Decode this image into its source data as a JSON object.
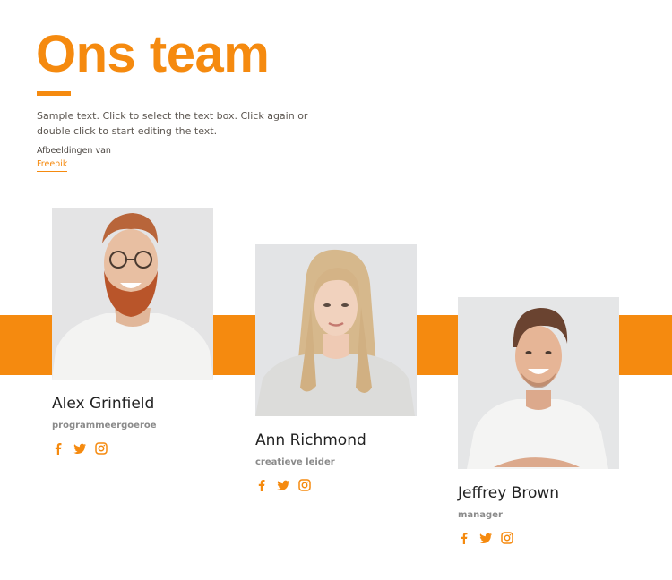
{
  "header": {
    "title": "Ons team",
    "intro": "Sample text. Click to select the text box. Click again or double click to start editing the text.",
    "credit_label": "Afbeeldingen van",
    "credit_link": "Freepik"
  },
  "colors": {
    "accent": "#f58a0f",
    "photo_bg": "#e5e5e6",
    "name_text": "#222222",
    "role_text": "#8a8a8a"
  },
  "team": [
    {
      "name": "Alex Grinfield",
      "role": "programmeergoeroe",
      "photo": "man with red beard and glasses, white t-shirt",
      "socials": [
        "facebook-icon",
        "twitter-icon",
        "instagram-icon"
      ]
    },
    {
      "name": "Ann Richmond",
      "role": "creatieve leider",
      "photo": "woman with long blonde hair, grey sweater",
      "socials": [
        "facebook-icon",
        "twitter-icon",
        "instagram-icon"
      ]
    },
    {
      "name": "Jeffrey Brown",
      "role": "manager",
      "photo": "smiling man with short brown hair, white t-shirt, arms crossed",
      "socials": [
        "facebook-icon",
        "twitter-icon",
        "instagram-icon"
      ]
    }
  ]
}
